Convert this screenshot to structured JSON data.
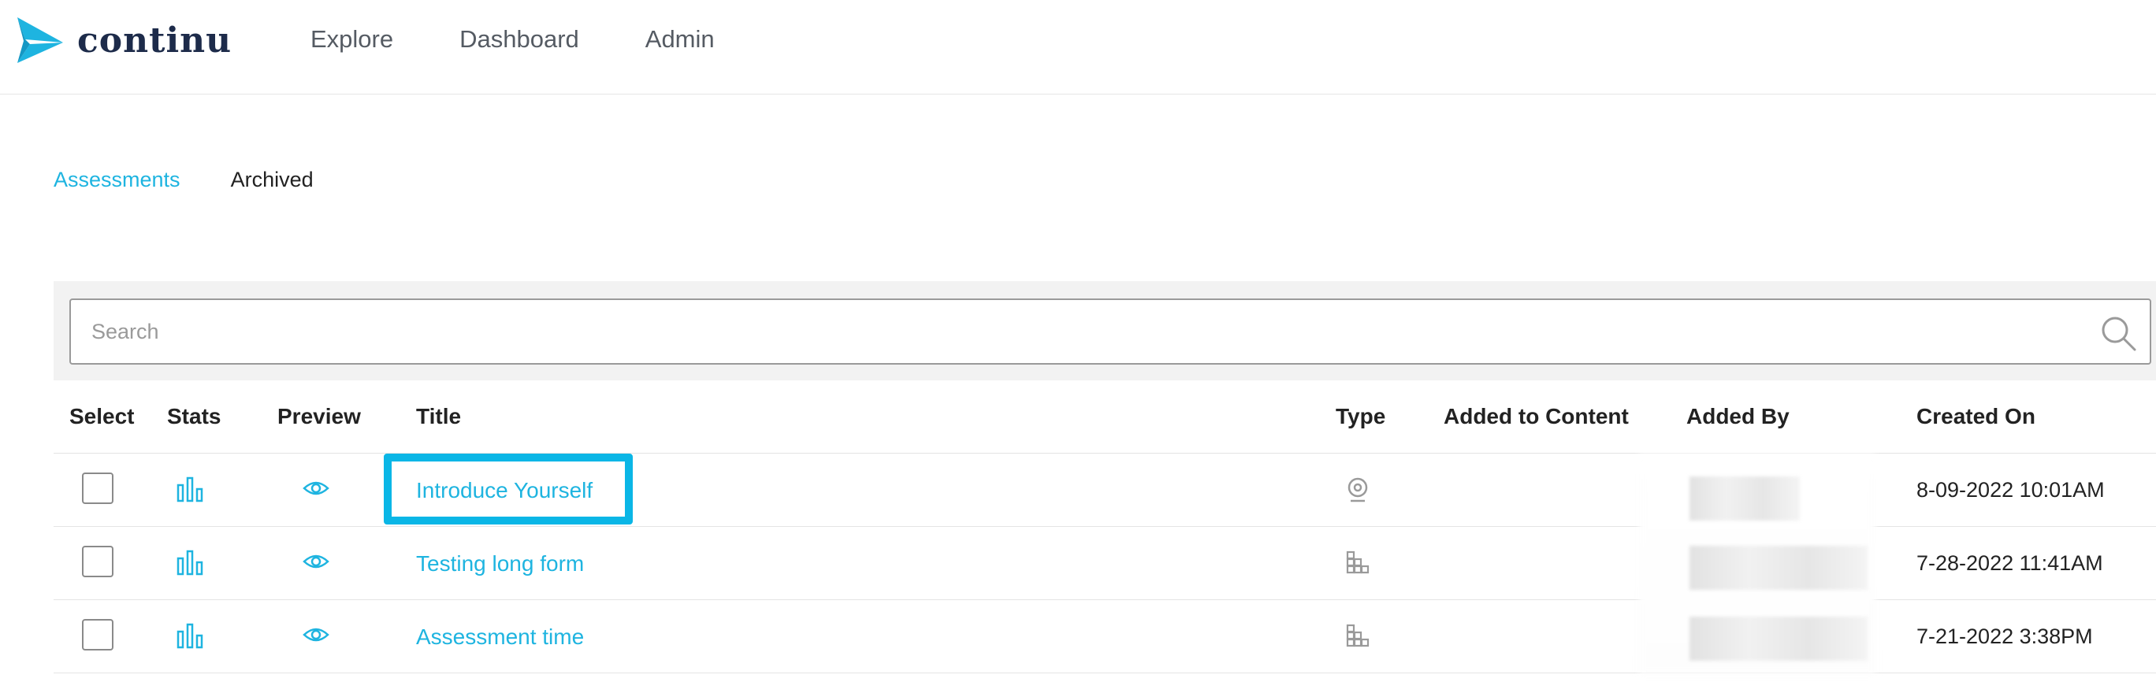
{
  "brand": {
    "name": "continu",
    "accent": "#1eb4e0",
    "logo_color": "#1d2b4a"
  },
  "nav": {
    "items": [
      "Explore",
      "Dashboard",
      "Admin"
    ]
  },
  "tabs": [
    {
      "label": "Assessments",
      "active": true
    },
    {
      "label": "Archived",
      "active": false
    }
  ],
  "search": {
    "placeholder": "Search",
    "value": "",
    "icon": "search-icon"
  },
  "table": {
    "headers": {
      "select": "Select",
      "stats": "Stats",
      "preview": "Preview",
      "title": "Title",
      "type": "Type",
      "added_to_content": "Added to Content",
      "added_by": "Added By",
      "created_on": "Created On"
    },
    "rows": [
      {
        "title": "Introduce Yourself",
        "type_icon": "webcam-icon",
        "created_on": "8-09-2022 10:01AM",
        "highlighted": true
      },
      {
        "title": "Testing long form",
        "type_icon": "form-blocks-icon",
        "created_on": "7-28-2022 11:41AM",
        "highlighted": false
      },
      {
        "title": "Assessment time",
        "type_icon": "form-blocks-icon",
        "created_on": "7-21-2022 3:38PM",
        "highlighted": false
      }
    ]
  }
}
